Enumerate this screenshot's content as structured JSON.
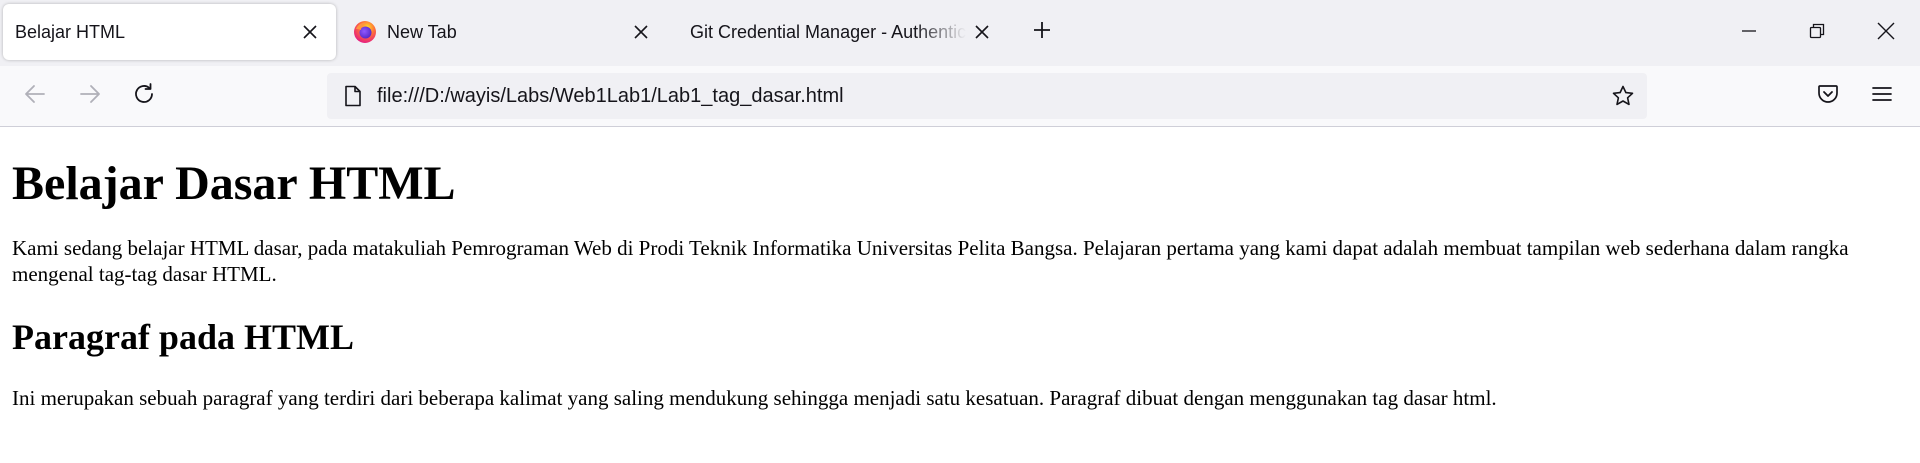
{
  "tabs": [
    {
      "title": "Belajar HTML",
      "active": true,
      "favicon": "none"
    },
    {
      "title": "New Tab",
      "active": false,
      "favicon": "firefox-icon"
    },
    {
      "title": "Git Credential Manager - Authentication",
      "active": false,
      "favicon": "none"
    }
  ],
  "address_bar": {
    "url": "file:///D:/wayis/Labs/Web1Lab1/Lab1_tag_dasar.html"
  },
  "page": {
    "heading": "Belajar Dasar HTML",
    "paragraph1": "Kami sedang belajar HTML dasar, pada matakuliah Pemrograman Web di Prodi Teknik Informatika Universitas Pelita Bangsa. Pelajaran pertama yang kami dapat adalah membuat tampilan web sederhana dalam rangka mengenal tag-tag dasar HTML.",
    "subheading": "Paragraf pada HTML",
    "paragraph2": "Ini merupakan sebuah paragraf yang terdiri dari beberapa kalimat yang saling mendukung sehingga menjadi satu kesatuan. Paragraf dibuat dengan menggunakan tag dasar html."
  },
  "colors": {
    "tabstrip_bg": "#f0f0f4",
    "navbar_bg": "#f9f9fb",
    "urlbar_bg": "#f0f0f4",
    "text": "#15141a"
  }
}
